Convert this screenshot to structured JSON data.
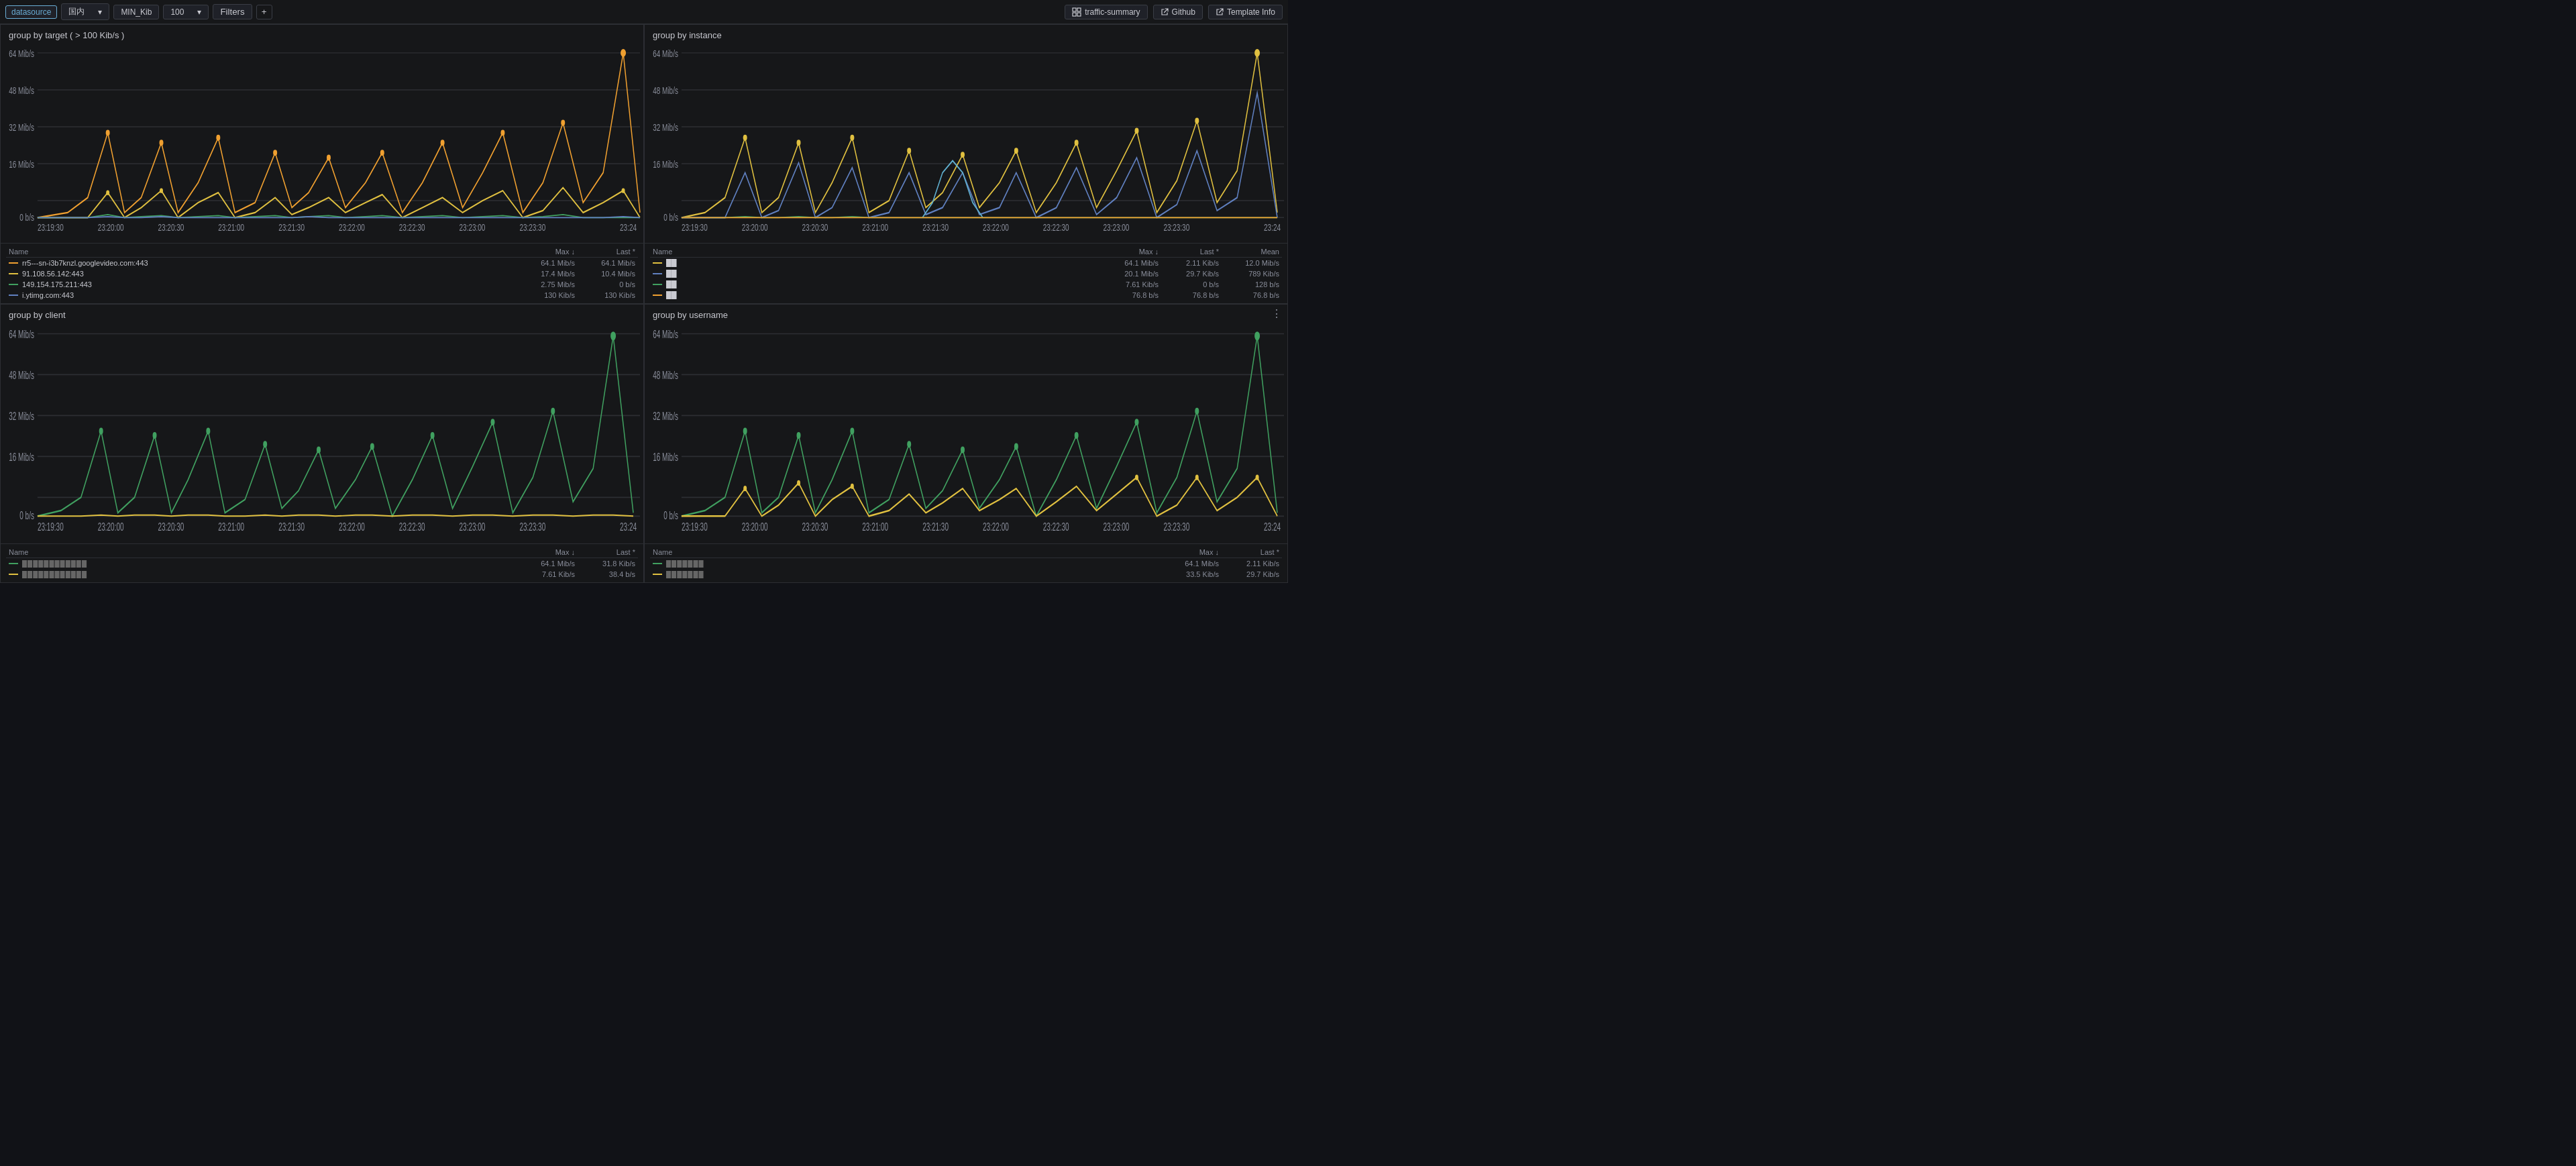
{
  "topbar": {
    "datasource_label": "datasource",
    "region_label": "国内",
    "metric_label": "MIN_Kib",
    "value_label": "100",
    "filters_label": "Filters",
    "add_label": "+",
    "nav_items": [
      {
        "id": "traffic-summary",
        "label": "traffic-summary",
        "icon": "grid-icon"
      },
      {
        "id": "github",
        "label": "Github",
        "icon": "external-link-icon"
      },
      {
        "id": "template-info",
        "label": "Template Info",
        "icon": "external-link-icon"
      }
    ]
  },
  "panels": [
    {
      "id": "panel-target",
      "title": "group by target ( > 100 Kib/s )",
      "position": "top-left",
      "y_labels": [
        "64 Mib/s",
        "48 Mib/s",
        "32 Mib/s",
        "16 Mib/s",
        "0 b/s"
      ],
      "x_labels": [
        "23:19:30",
        "23:20:00",
        "23:20:30",
        "23:21:00",
        "23:21:30",
        "23:22:00",
        "23:22:30",
        "23:23:00",
        "23:23:30",
        "23:24"
      ],
      "legend_headers": [
        "Name",
        "Max ↓",
        "Last *"
      ],
      "legend_rows": [
        {
          "color": "#f0a030",
          "name": "rr5---sn-i3b7knzl.googlevideo.com:443",
          "max": "64.1 Mib/s",
          "last": "64.1 Mib/s"
        },
        {
          "color": "#e0c040",
          "name": "91.108.56.142:443",
          "max": "17.4 Mib/s",
          "last": "10.4 Mib/s"
        },
        {
          "color": "#40a060",
          "name": "149.154.175.211:443",
          "max": "2.75 Mib/s",
          "last": "0 b/s"
        },
        {
          "color": "#6080c0",
          "name": "i.ytimg.com:443",
          "max": "130 Kib/s",
          "last": "130 Kib/s"
        }
      ]
    },
    {
      "id": "panel-instance",
      "title": "group by instance",
      "position": "top-right",
      "y_labels": [
        "64 Mib/s",
        "48 Mib/s",
        "32 Mib/s",
        "16 Mib/s",
        "0 b/s"
      ],
      "x_labels": [
        "23:19:30",
        "23:20:00",
        "23:20:30",
        "23:21:00",
        "23:21:30",
        "23:22:00",
        "23:22:30",
        "23:23:00",
        "23:23:30",
        "23:24"
      ],
      "legend_headers": [
        "Name",
        "Max ↓",
        "Last *",
        "Mean"
      ],
      "legend_rows": [
        {
          "color": "#e0c040",
          "name": "██",
          "max": "64.1 Mib/s",
          "last": "2.11 Kib/s",
          "mean": "12.0 Mib/s"
        },
        {
          "color": "#6080c0",
          "name": "██",
          "max": "20.1 Mib/s",
          "last": "29.7 Kib/s",
          "mean": "789 Kib/s"
        },
        {
          "color": "#40a060",
          "name": "██",
          "max": "7.61 Kib/s",
          "last": "0 b/s",
          "mean": "128 b/s"
        },
        {
          "color": "#f0a030",
          "name": "██",
          "max": "76.8 b/s",
          "last": "76.8 b/s",
          "mean": "76.8 b/s"
        }
      ]
    },
    {
      "id": "panel-client",
      "title": "group by client",
      "position": "bottom-left",
      "y_labels": [
        "64 Mib/s",
        "48 Mib/s",
        "32 Mib/s",
        "16 Mib/s",
        "0 b/s"
      ],
      "x_labels": [
        "23:19:30",
        "23:20:00",
        "23:20:30",
        "23:21:00",
        "23:21:30",
        "23:22:00",
        "23:22:30",
        "23:23:00",
        "23:23:30",
        "23:24"
      ],
      "legend_headers": [
        "Name",
        "Max ↓",
        "Last *"
      ],
      "legend_rows": [
        {
          "color": "#40a060",
          "name": "████████████",
          "max": "64.1 Mib/s",
          "last": "31.8 Kib/s"
        },
        {
          "color": "#e0c040",
          "name": "████████████",
          "max": "7.61 Kib/s",
          "last": "38.4 b/s"
        }
      ]
    },
    {
      "id": "panel-username",
      "title": "group by username",
      "position": "bottom-right",
      "y_labels": [
        "64 Mib/s",
        "48 Mib/s",
        "32 Mib/s",
        "16 Mib/s",
        "0 b/s"
      ],
      "x_labels": [
        "23:19:30",
        "23:20:00",
        "23:20:30",
        "23:21:00",
        "23:21:30",
        "23:22:00",
        "23:22:30",
        "23:23:00",
        "23:23:30",
        "23:24"
      ],
      "legend_headers": [
        "Name",
        "Max ↓",
        "Last *"
      ],
      "legend_rows": [
        {
          "color": "#40a060",
          "name": "███████",
          "max": "64.1 Mib/s",
          "last": "2.11 Kib/s"
        },
        {
          "color": "#e0c040",
          "name": "███████",
          "max": "33.5 Kib/s",
          "last": "29.7 Kib/s"
        }
      ]
    }
  ],
  "icons": {
    "grid": "⊞",
    "external_link": "↗",
    "chevron_down": "▾",
    "dots_vertical": "⋮"
  }
}
